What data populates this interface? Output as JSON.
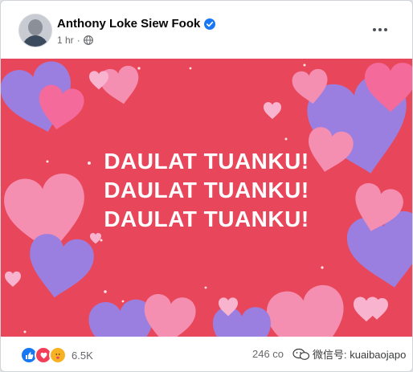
{
  "post": {
    "author": "Anthony Loke Siew Fook",
    "time": "1 hr",
    "separator": "·",
    "icons": {
      "verified": "verified-badge-icon",
      "audience": "globe-icon",
      "menu": "more-options-icon"
    }
  },
  "image": {
    "lines": [
      "DAULAT TUANKU!",
      "DAULAT TUANKU!",
      "DAULAT TUANKU!"
    ],
    "colors": {
      "background": "#e8475b",
      "pink": "#f48fb1",
      "purple": "#9b7fe0",
      "text": "#ffffff"
    }
  },
  "footer": {
    "reaction_icons": [
      "like-icon",
      "love-icon",
      "care-icon"
    ],
    "reaction_count": "6.5K",
    "comments_text": "246 co",
    "watermark_text": "微信号: kuaibaojapo"
  }
}
